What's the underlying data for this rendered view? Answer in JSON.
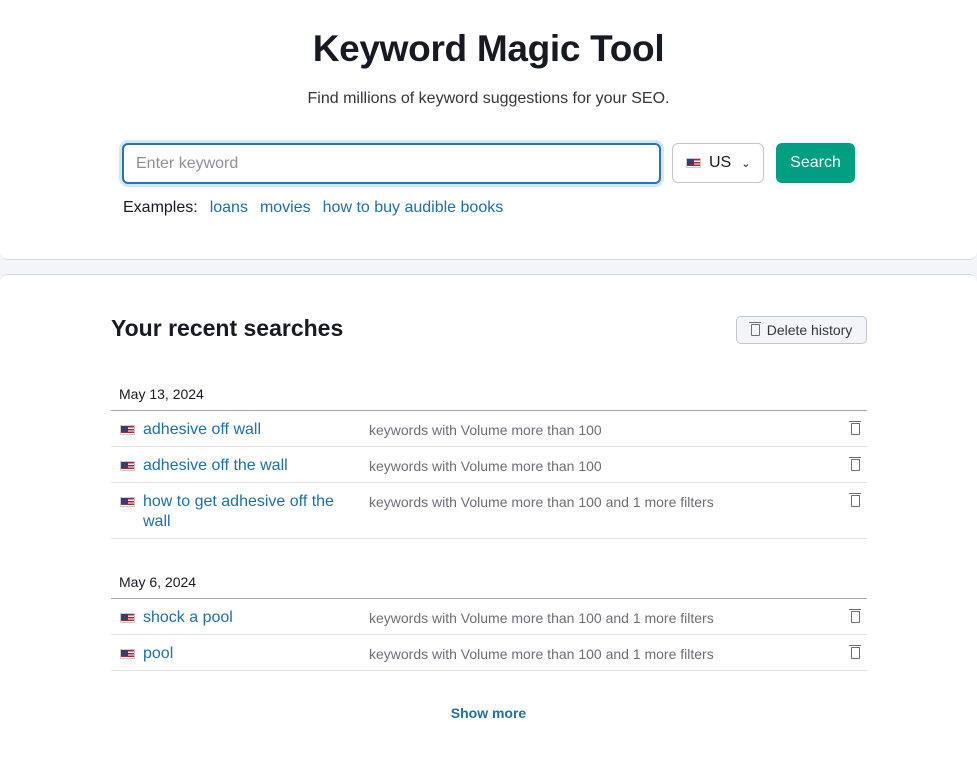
{
  "header": {
    "title": "Keyword Magic Tool",
    "subtitle": "Find millions of keyword suggestions for your SEO."
  },
  "search": {
    "placeholder": "Enter keyword",
    "value": "",
    "database": "US",
    "button_label": "Search"
  },
  "examples": {
    "label": "Examples:",
    "links": [
      "loans",
      "movies",
      "how to buy audible books"
    ]
  },
  "recent": {
    "title": "Your recent searches",
    "delete_label": "Delete history",
    "groups": [
      {
        "date": "May 13, 2024",
        "items": [
          {
            "keyword": "adhesive off wall",
            "desc": "keywords with Volume more than 100"
          },
          {
            "keyword": "adhesive off the wall",
            "desc": "keywords with Volume more than 100"
          },
          {
            "keyword": "how to get adhesive off the wall",
            "desc": "keywords with Volume more than 100 and 1 more filters"
          }
        ]
      },
      {
        "date": "May 6, 2024",
        "items": [
          {
            "keyword": "shock a pool",
            "desc": "keywords with Volume more than 100 and 1 more filters"
          },
          {
            "keyword": "pool",
            "desc": "keywords with Volume more than 100 and 1 more filters"
          }
        ]
      }
    ],
    "show_more": "Show more"
  },
  "colors": {
    "accent": "#009f81",
    "link": "#1f6fa8",
    "focus_border": "#2a72b5"
  },
  "icons": {
    "flag": "us-flag-icon",
    "dropdown": "chevron-down-icon",
    "delete": "trash-icon"
  }
}
